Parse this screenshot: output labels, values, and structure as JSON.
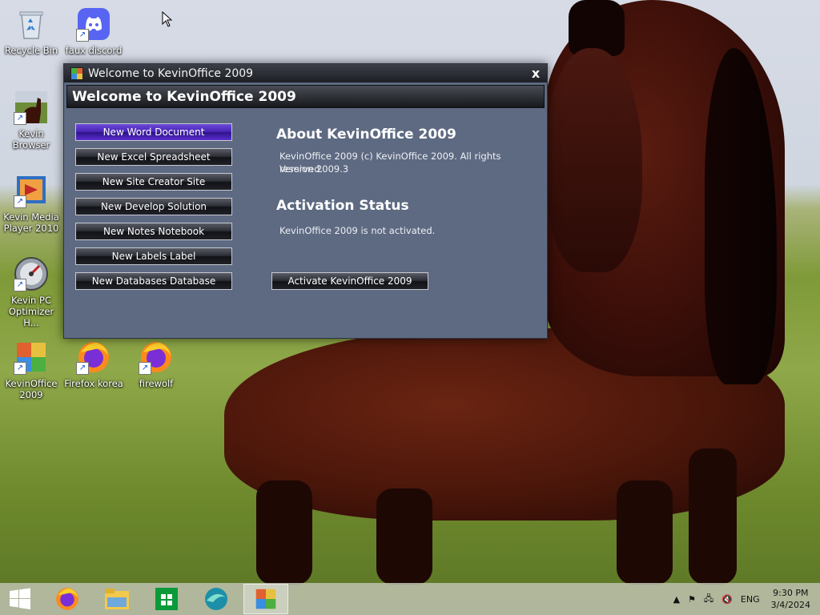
{
  "desktop": {
    "icons": [
      {
        "label": "Recycle Bin"
      },
      {
        "label": "faux discord"
      },
      {
        "label": "Kevin Browser"
      },
      {
        "label": "Kevin Media Player 2010"
      },
      {
        "label": "Kevin PC Optimizer H..."
      },
      {
        "label": "KevinOffice 2009"
      },
      {
        "label": "Firefox korea"
      },
      {
        "label": "firewolf"
      }
    ]
  },
  "window": {
    "title": "Welcome to KevinOffice 2009",
    "close_label": "x",
    "header": "Welcome to KevinOffice 2009",
    "buttons": [
      {
        "label": "New Word Document"
      },
      {
        "label": "New Excel Spreadsheet"
      },
      {
        "label": "New Site Creator Site"
      },
      {
        "label": "New Develop Solution"
      },
      {
        "label": "New Notes Notebook"
      },
      {
        "label": "New Labels Label"
      },
      {
        "label": "New Databases Database"
      }
    ],
    "about": {
      "title": "About KevinOffice 2009",
      "line1": "KevinOffice 2009 (c) KevinOffice 2009. All rights reserved.",
      "line2": "Version 2009.3"
    },
    "activation": {
      "title": "Activation Status",
      "status": "KevinOffice 2009 is not activated.",
      "button": "Activate KevinOffice 2009"
    }
  },
  "taskbar": {
    "items": [
      "start-button",
      "firefox",
      "file-explorer",
      "store",
      "edge-like-browser",
      "kevinoffice"
    ],
    "tray": {
      "lang": "ENG",
      "time": "9:30 PM",
      "date": "3/4/2024"
    }
  },
  "colors": {
    "window_bg": "#5e6a82",
    "active_button": "#4a24b4"
  }
}
